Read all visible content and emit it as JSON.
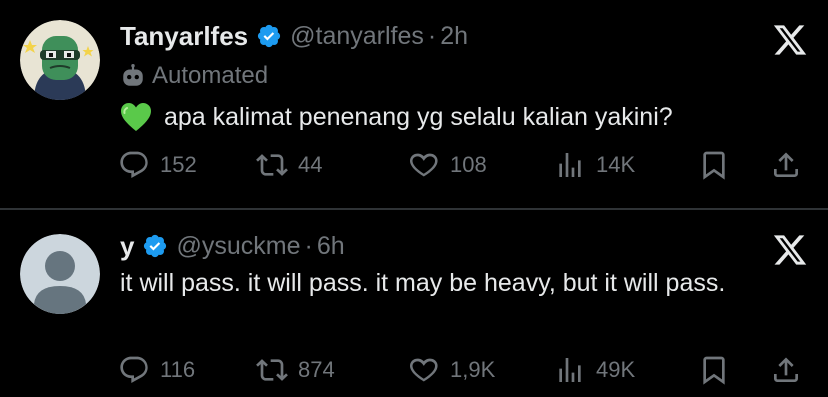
{
  "tweets": [
    {
      "display_name": "Tanyarlfes",
      "handle": "@tanyarlfes",
      "separator": "·",
      "time": "2h",
      "automated_label": "Automated",
      "text": "apa kalimat penenang yg selalu kalian yakini?",
      "emoji": "green-heart",
      "replies": "152",
      "reposts": "44",
      "likes": "108",
      "views": "14K"
    },
    {
      "display_name": "y",
      "handle": "@ysuckme",
      "separator": "·",
      "time": "6h",
      "text": "it will pass. it will pass. it may be heavy, but it will pass.",
      "replies": "116",
      "reposts": "874",
      "likes": "1,9K",
      "views": "49K"
    }
  ],
  "colors": {
    "background": "#000000",
    "primary_text": "#e7e9ea",
    "secondary_text": "#71767b",
    "verified_blue": "#1d9bf0",
    "divider": "#2f3336"
  }
}
